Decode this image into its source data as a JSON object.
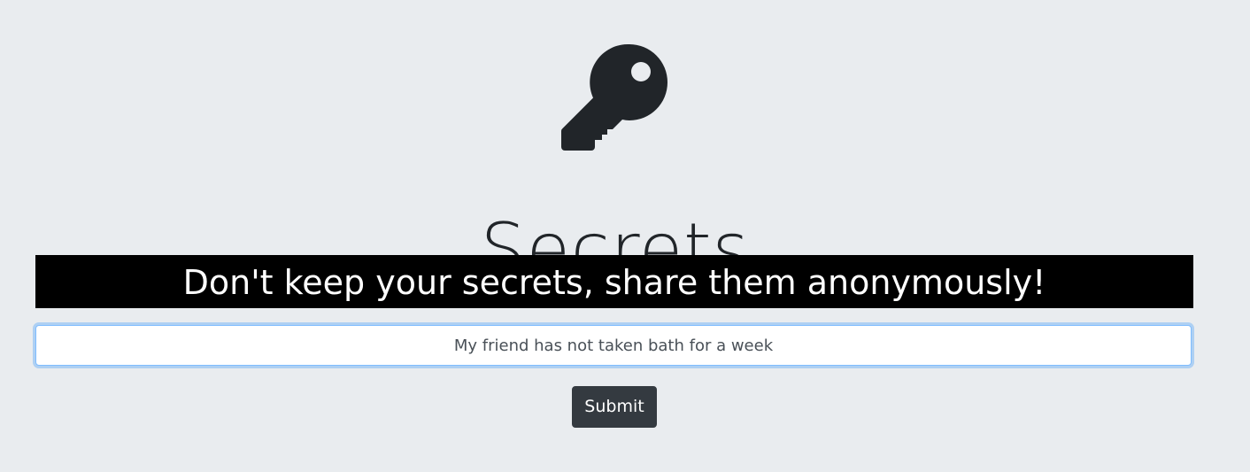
{
  "header": {
    "icon": "key-icon",
    "title": "Secrets",
    "tagline": "Don't keep your secrets, share them anonymously!"
  },
  "form": {
    "secret_value": "My friend has not taken bath for a week",
    "submit_label": "Submit"
  },
  "colors": {
    "background": "#e9ecef",
    "tagline_bg": "#000000",
    "button_bg": "#343a40"
  }
}
